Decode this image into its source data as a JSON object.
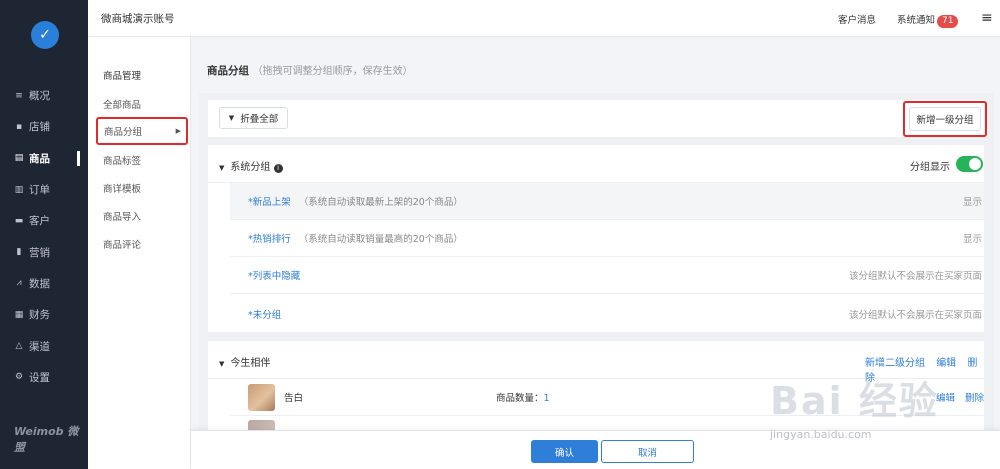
{
  "sidebar": {
    "items": [
      {
        "label": "概况",
        "icon": "list-icon"
      },
      {
        "label": "店铺",
        "icon": "store-icon"
      },
      {
        "label": "商品",
        "icon": "goods-icon",
        "active": true
      },
      {
        "label": "订单",
        "icon": "order-icon"
      },
      {
        "label": "客户",
        "icon": "customer-icon"
      },
      {
        "label": "营销",
        "icon": "bar-chart-icon"
      },
      {
        "label": "数据",
        "icon": "line-chart-icon"
      },
      {
        "label": "财务",
        "icon": "finance-icon"
      },
      {
        "label": "渠道",
        "icon": "channel-icon"
      },
      {
        "label": "设置",
        "icon": "gear-icon"
      }
    ],
    "brand": "Weimob 微盟"
  },
  "topbar": {
    "account": "微商城演示账号",
    "messages": "客户消息",
    "notifications": "系统通知",
    "notif_count": "71"
  },
  "subnav": {
    "title": "商品管理",
    "items": [
      "全部商品",
      "商品分组",
      "商品标签",
      "商详模板",
      "商品导入",
      "商品评论"
    ],
    "selected": "商品分组"
  },
  "page": {
    "title": "商品分组",
    "hint": "（拖拽可调整分组顺序，保存生效）",
    "collapse_label": "折叠全部",
    "add_top_group_label": "新增一级分组"
  },
  "system_group": {
    "title": "系统分组",
    "toggle_label": "分组显示",
    "toggle_on": true,
    "rows": [
      {
        "name": "*新品上架",
        "desc": "（系统自动读取最新上架的20个商品）",
        "right": "显示"
      },
      {
        "name": "*热销排行",
        "desc": "（系统自动读取销量最高的20个商品）",
        "right": "显示"
      },
      {
        "name": "*列表中隐藏",
        "desc": "",
        "right": "该分组默认不会展示在买家页面"
      },
      {
        "name": "*未分组",
        "desc": "",
        "right": "该分组默认不会展示在买家页面"
      }
    ]
  },
  "custom_group": {
    "title": "今生相伴",
    "actions": {
      "add_sub": "新增二级分组",
      "edit": "编辑",
      "delete": "删除"
    },
    "rows": [
      {
        "name": "告白",
        "count_label": "商品数量：",
        "count": "1",
        "edit": "编辑",
        "delete": "删除"
      }
    ]
  },
  "footer": {
    "confirm": "确认",
    "cancel": "取消"
  },
  "watermark": {
    "text": "Bai 经验",
    "sub": "jingyan.baidu.com"
  },
  "colors": {
    "accent": "#2f7ed8",
    "sidebar_bg": "#1f2633",
    "highlight_border": "#e12b2b",
    "toggle_on": "#27b35a",
    "badge": "#e54b4b"
  }
}
